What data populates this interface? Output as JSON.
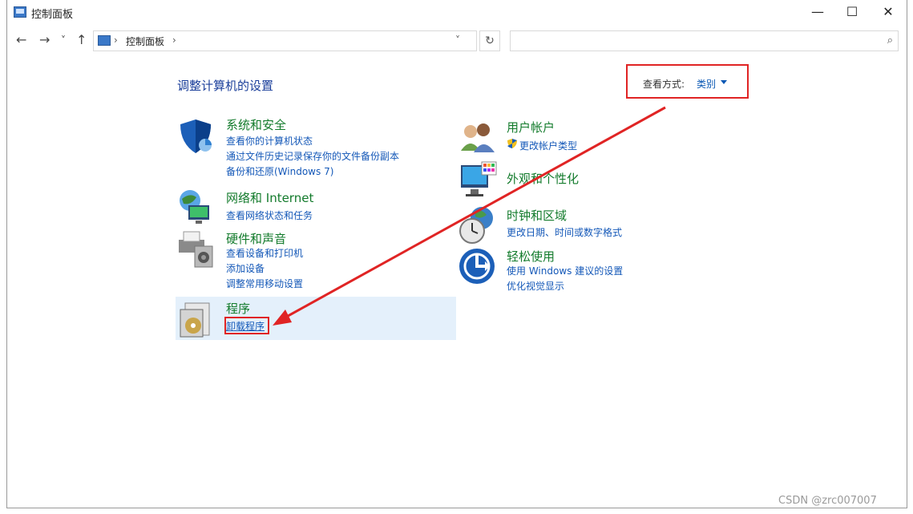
{
  "window": {
    "title": "控制面板"
  },
  "window_controls": {
    "minimize": "—",
    "maximize": "☐",
    "close": "✕"
  },
  "navigation": {
    "back": "←",
    "forward": "→",
    "recent": "˅",
    "up": "↑"
  },
  "address": {
    "path": "控制面板",
    "sep1": "›",
    "sep2": "›",
    "dropdown": "˅",
    "refresh": "↻"
  },
  "search": {
    "value": "",
    "placeholder": "",
    "icon": "⌕"
  },
  "main": {
    "heading": "调整计算机的设置",
    "view_by": {
      "label": "查看方式:",
      "value": "类别"
    },
    "left": [
      {
        "title": "系统和安全",
        "icon": "shield-icon",
        "links": [
          "查看你的计算机状态",
          "通过文件历史记录保存你的文件备份副本",
          "备份和还原(Windows 7)"
        ]
      },
      {
        "title": "网络和 Internet",
        "icon": "network-globe-icon",
        "links": [
          "查看网络状态和任务"
        ]
      },
      {
        "title": "硬件和声音",
        "icon": "printer-speaker-icon",
        "links": [
          "查看设备和打印机",
          "添加设备",
          "调整常用移动设置"
        ]
      },
      {
        "title": "程序",
        "icon": "program-disc-icon",
        "links": [
          "卸载程序"
        ]
      }
    ],
    "right": [
      {
        "title": "用户帐户",
        "icon": "users-icon",
        "links": [
          "更改帐户类型"
        ]
      },
      {
        "title": "外观和个性化",
        "icon": "monitor-palette-icon",
        "links": []
      },
      {
        "title": "时钟和区域",
        "icon": "clock-globe-icon",
        "links": [
          "更改日期、时间或数字格式"
        ]
      },
      {
        "title": "轻松使用",
        "icon": "accessibility-icon",
        "links": [
          "使用 Windows 建议的设置",
          "优化视觉显示"
        ]
      }
    ]
  },
  "watermark": "CSDN @zrc007007",
  "colors": {
    "title_green": "#137b2c",
    "link_blue": "#1458b8",
    "annotation_red": "#e02424",
    "highlight": "#e4f0fb"
  }
}
